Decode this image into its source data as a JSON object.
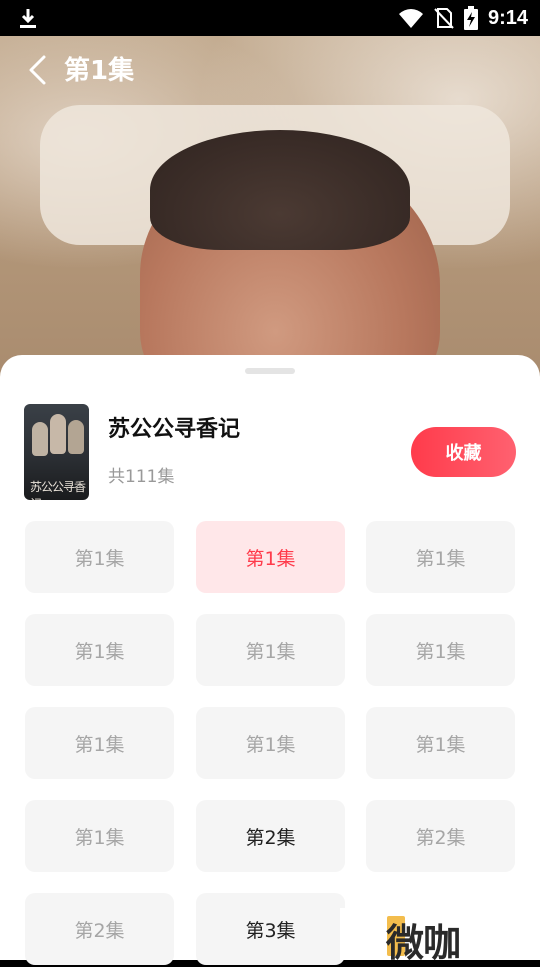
{
  "status_bar": {
    "time": "9:14",
    "icons": [
      "download-icon",
      "wifi-icon",
      "no-sim-icon",
      "battery-charging-icon"
    ]
  },
  "header": {
    "title": "第1集"
  },
  "drama": {
    "title": "苏公公寻香记",
    "episode_count": "共111集",
    "poster_text": "苏公公寻香记",
    "favorite_label": "收藏"
  },
  "episodes": [
    {
      "label": "第1集",
      "state": "normal"
    },
    {
      "label": "第1集",
      "state": "active"
    },
    {
      "label": "第1集",
      "state": "normal"
    },
    {
      "label": "第1集",
      "state": "normal"
    },
    {
      "label": "第1集",
      "state": "normal"
    },
    {
      "label": "第1集",
      "state": "normal"
    },
    {
      "label": "第1集",
      "state": "normal"
    },
    {
      "label": "第1集",
      "state": "normal"
    },
    {
      "label": "第1集",
      "state": "normal"
    },
    {
      "label": "第1集",
      "state": "normal"
    },
    {
      "label": "第2集",
      "state": "dark"
    },
    {
      "label": "第2集",
      "state": "normal"
    },
    {
      "label": "第2集",
      "state": "normal"
    },
    {
      "label": "第3集",
      "state": "dark"
    }
  ],
  "watermark": {
    "text": "微咖"
  },
  "colors": {
    "accent": "#ff3b4b",
    "active_bg": "#ffe7e9",
    "cell_bg": "#f5f5f5",
    "muted_text": "#a6a6a6"
  }
}
